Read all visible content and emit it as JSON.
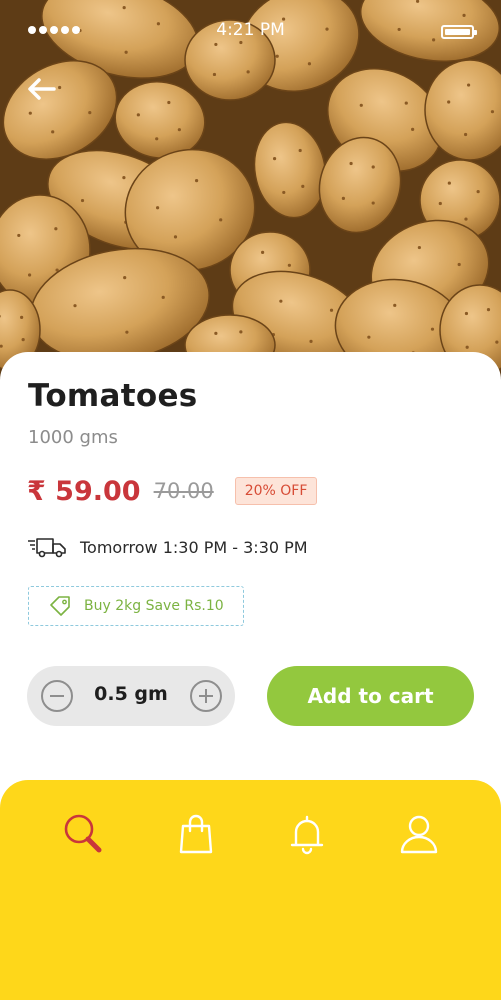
{
  "status_bar": {
    "time": "4:21 PM"
  },
  "product": {
    "name": "Tomatoes",
    "weight": "1000 gms",
    "price": "₹ 59.00",
    "original_price": "70.00",
    "discount": "20% OFF",
    "delivery": "Tomorrow 1:30 PM - 3:30 PM",
    "offer": "Buy 2kg Save Rs.10"
  },
  "quantity": {
    "value": "0.5 gm"
  },
  "actions": {
    "add_to_cart": "Add to cart"
  },
  "bottom_nav": {
    "items": [
      {
        "icon": "search-icon",
        "active": true
      },
      {
        "icon": "bag-icon",
        "active": false
      },
      {
        "icon": "bell-icon",
        "active": false
      },
      {
        "icon": "user-icon",
        "active": false
      }
    ]
  },
  "colors": {
    "price": "#c9363b",
    "accent_green": "#93c83e",
    "nav_background": "#fed71a",
    "nav_active_icon": "#c9363b",
    "nav_icon": "#ffffff"
  }
}
